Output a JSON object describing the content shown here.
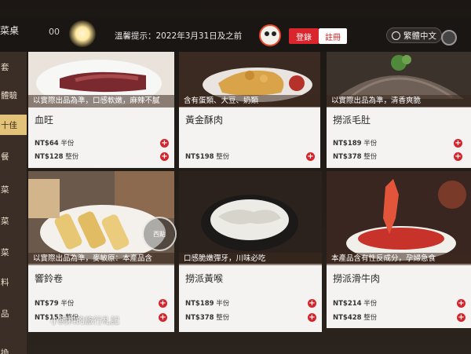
{
  "header": {
    "brand_label": "菜桌",
    "indicator_label": "00",
    "notice": "溫馨提示：2022年3月31日及之前",
    "login_label": "登錄",
    "register_label": "註冊",
    "language_label": "繁體中文"
  },
  "sidebar": {
    "items": [
      {
        "label": "套"
      },
      {
        "label": "體驗"
      },
      {
        "label": "十佳"
      },
      {
        "label": "餐"
      },
      {
        "label": "菜"
      },
      {
        "label": "菜"
      },
      {
        "label": "菜"
      },
      {
        "label": "料"
      },
      {
        "label": "品"
      },
      {
        "label": "換"
      }
    ]
  },
  "menu": {
    "items": [
      {
        "caption": "以實際出品為準，口感軟嫩，麻辣不膩",
        "name": "血旺",
        "prices": [
          {
            "currency": "NT$",
            "amount": "64",
            "portion": "半份"
          },
          {
            "currency": "NT$",
            "amount": "128",
            "portion": "整份"
          }
        ]
      },
      {
        "caption": "含有蛋類、大豆、奶類",
        "name": "黃金酥肉",
        "prices": [
          {
            "currency": "NT$",
            "amount": "198",
            "portion": "整份"
          }
        ]
      },
      {
        "caption": "以實際出品為準，清香爽脆",
        "name": "撈派毛肚",
        "prices": [
          {
            "currency": "NT$",
            "amount": "189",
            "portion": "半份"
          },
          {
            "currency": "NT$",
            "amount": "378",
            "portion": "整份"
          }
        ]
      },
      {
        "caption": "以實際出品為準，麥敏原：本產品含",
        "name": "響鈴卷",
        "prices": [
          {
            "currency": "NT$",
            "amount": "79",
            "portion": "半份"
          },
          {
            "currency": "NT$",
            "amount": "153",
            "portion": "整份"
          }
        ]
      },
      {
        "caption": "口感脆嫩彈牙，川味必吃",
        "name": "撈派黃喉",
        "prices": [
          {
            "currency": "NT$",
            "amount": "189",
            "portion": "半份"
          },
          {
            "currency": "NT$",
            "amount": "378",
            "portion": "整份"
          }
        ]
      },
      {
        "caption": "本產品含有性反成分，孕婦急食",
        "name": "撈派滑牛肉",
        "prices": [
          {
            "currency": "NT$",
            "amount": "214",
            "portion": "半份"
          },
          {
            "currency": "NT$",
            "amount": "428",
            "portion": "整份"
          }
        ]
      }
    ]
  },
  "watermark": "小飼料的旅行札記",
  "stamp_label": "西點",
  "colors": {
    "accent_red": "#d3262c",
    "sidebar_bg": "#3a2e27",
    "sidebar_active": "#e3c37a",
    "card_bg": "#f5f3f1"
  }
}
